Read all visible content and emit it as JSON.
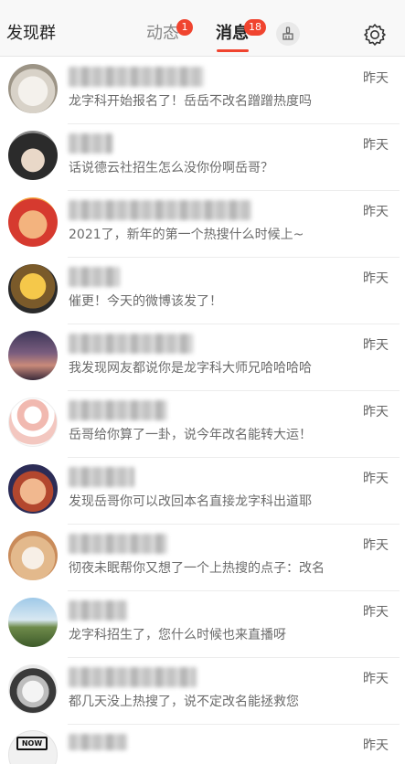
{
  "header": {
    "left_title": "发现群",
    "tabs": [
      {
        "label": "动态",
        "badge": "1"
      },
      {
        "label": "消息",
        "badge": "18"
      }
    ]
  },
  "icons": {
    "broom": "broom-icon",
    "settings": "gear-icon"
  },
  "colors": {
    "accent": "#f0442f",
    "background": "#ffffff",
    "header_background": "#f8f8f8"
  },
  "messages": [
    {
      "time": "昨天",
      "text": "龙字科开始报名了！岳岳不改名蹭蹭热度吗"
    },
    {
      "time": "昨天",
      "text": "话说德云社招生怎么没你份啊岳哥？"
    },
    {
      "time": "昨天",
      "text": "2021了，新年的第一个热搜什么时候上~"
    },
    {
      "time": "昨天",
      "text": "催更！今天的微博该发了！"
    },
    {
      "time": "昨天",
      "text": "我发现网友都说你是龙字科大师兄哈哈哈哈"
    },
    {
      "time": "昨天",
      "text": "岳哥给你算了一卦，说今年改名能转大运！"
    },
    {
      "time": "昨天",
      "text": "发现岳哥你可以改回本名直接龙字科出道耶"
    },
    {
      "time": "昨天",
      "text": "彻夜未眠帮你又想了一个上热搜的点子：改名"
    },
    {
      "time": "昨天",
      "text": "龙字科招生了，您什么时候也来直播呀"
    },
    {
      "time": "昨天",
      "text": "都几天没上热搜了，说不定改名能拯救您"
    },
    {
      "time": "昨天",
      "text": "",
      "logo": "NOW"
    }
  ]
}
